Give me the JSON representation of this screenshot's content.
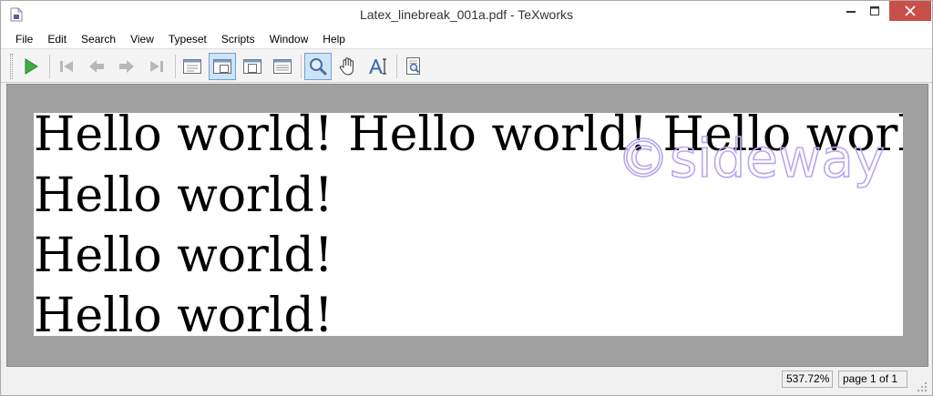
{
  "window": {
    "title": "Latex_linebreak_001a.pdf - TeXworks"
  },
  "menu": {
    "items": [
      "File",
      "Edit",
      "Search",
      "View",
      "Typeset",
      "Scripts",
      "Window",
      "Help"
    ]
  },
  "toolbar": {
    "buttons": [
      {
        "icon": "typeset-play-icon"
      },
      {
        "icon": "first-page-icon"
      },
      {
        "icon": "previous-page-icon"
      },
      {
        "icon": "next-page-icon"
      },
      {
        "icon": "last-page-icon"
      },
      {
        "icon": "actual-size-icon"
      },
      {
        "icon": "fit-width-icon",
        "active": true
      },
      {
        "icon": "fit-page-icon"
      },
      {
        "icon": "fit-window-icon"
      },
      {
        "icon": "magnifier-icon",
        "active": true
      },
      {
        "icon": "hand-scroll-icon"
      },
      {
        "icon": "select-text-icon"
      },
      {
        "icon": "find-in-pdf-icon"
      }
    ]
  },
  "document": {
    "lines": [
      "Hello world!  Hello world!  Hello world!",
      "Hello world!",
      "Hello world!",
      "Hello world!"
    ],
    "watermark": "©sideway"
  },
  "status": {
    "zoom": "537.72%",
    "page_info": "page 1 of 1"
  },
  "colors": {
    "close_button": "#c7504a",
    "viewer_background": "#a0a0a0",
    "active_tool": "#cde3f7",
    "watermark": "#b9a6ef"
  }
}
